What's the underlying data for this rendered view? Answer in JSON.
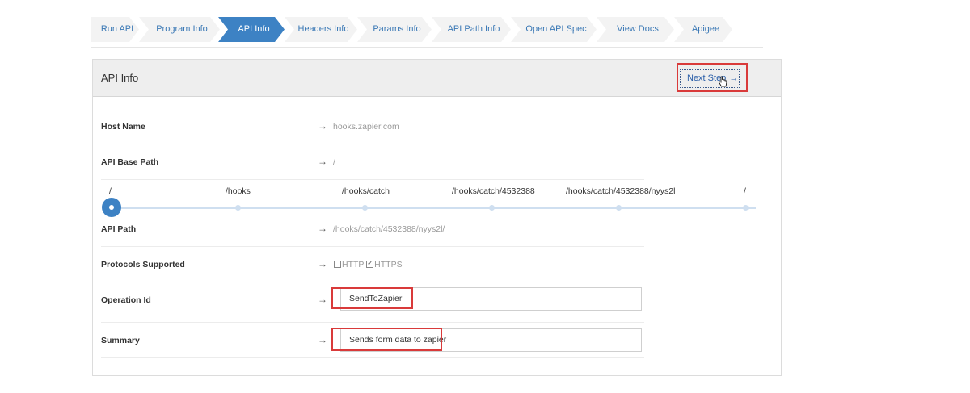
{
  "steps": [
    {
      "label": "Run API"
    },
    {
      "label": "Program Info"
    },
    {
      "label": "API Info"
    },
    {
      "label": "Headers Info"
    },
    {
      "label": "Params Info"
    },
    {
      "label": "API Path Info"
    },
    {
      "label": "Open API Spec"
    },
    {
      "label": "View Docs"
    },
    {
      "label": "Apigee"
    }
  ],
  "panel": {
    "title": "API Info",
    "next_step_label": "Next Step",
    "next_step_arrow": "→"
  },
  "fields": {
    "arrow": "→",
    "host_name": {
      "label": "Host Name",
      "value": "hooks.zapier.com"
    },
    "api_base_path": {
      "label": "API Base Path",
      "value": "/"
    },
    "api_path": {
      "label": "API Path",
      "value": "/hooks/catch/4532388/nyys2l/"
    },
    "protocols": {
      "label": "Protocols Supported",
      "http_label": "HTTP",
      "http_checked": false,
      "https_label": "HTTPS",
      "https_checked": true
    },
    "operation_id": {
      "label": "Operation Id",
      "value": "SendToZapier"
    },
    "summary": {
      "label": "Summary",
      "value": "Sends form data to zapier"
    }
  },
  "path_slider": {
    "labels": [
      "/",
      "/hooks",
      "/hooks/catch",
      "/hooks/catch/4532388",
      "/hooks/catch/4532388/nyys2l",
      "/"
    ],
    "selected_index": 0
  },
  "colors": {
    "accent": "#3d82c4",
    "highlight": "#d93a3a",
    "link": "#2a5ea8"
  }
}
